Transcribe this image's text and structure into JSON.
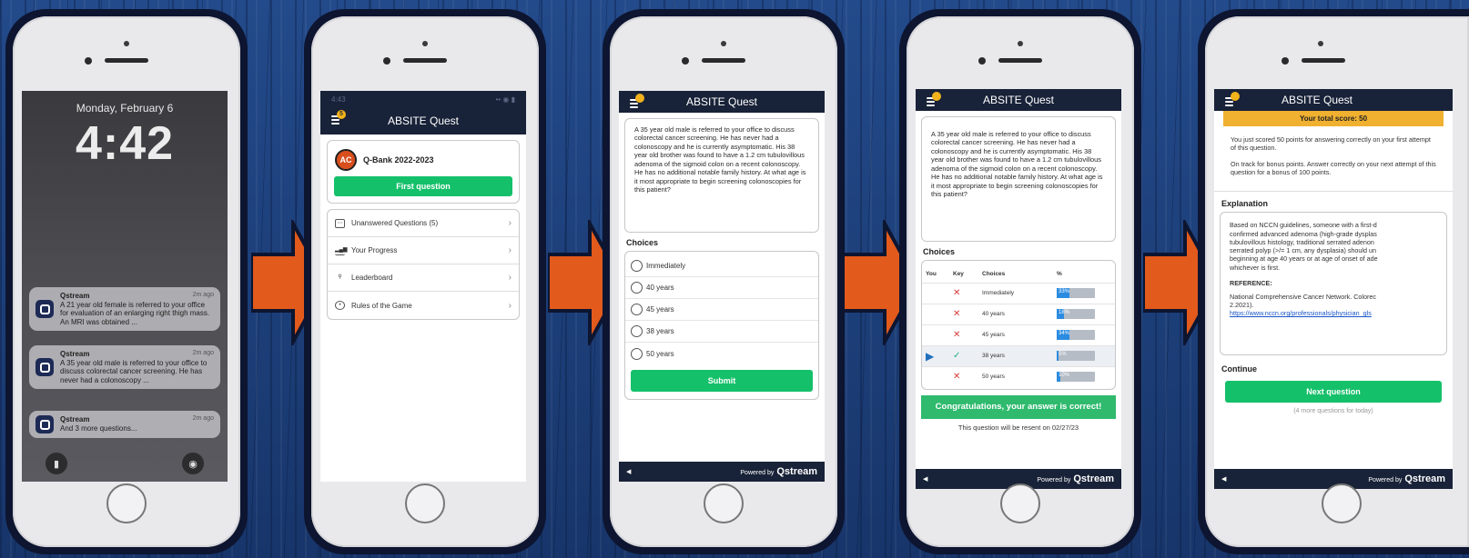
{
  "screen1": {
    "date": "Monday, February 6",
    "time": "4:42",
    "notifications": [
      {
        "app": "Qstream",
        "ago": "2m ago",
        "text": "A 21 year old female is referred to your office for evaluation of an enlarging right thigh mass. An MRI was obtained ..."
      },
      {
        "app": "Qstream",
        "ago": "2m ago",
        "text": "A 35 year old male is referred to your office to discuss colorectal cancer screening. He has never had a colonoscopy ..."
      },
      {
        "app": "Qstream",
        "ago": "2m ago",
        "text": "And 3 more questions..."
      }
    ]
  },
  "screen2": {
    "status_time": "4:43",
    "header_title": "ABSITE Quest",
    "coin_count": "5",
    "logo_text": "AC",
    "qbank_title": "Q-Bank 2022-2023",
    "first_question": "First question",
    "menu": [
      {
        "label": "Unanswered Questions (5)",
        "icon": "calendar-icon"
      },
      {
        "label": "Your Progress",
        "icon": "bar-chart-icon"
      },
      {
        "label": "Leaderboard",
        "icon": "trophy-icon"
      },
      {
        "label": "Rules of the Game",
        "icon": "help-icon"
      }
    ]
  },
  "question_text": "A 35 year old male is referred to your office to discuss colorectal cancer screening. He has never had a colonoscopy and he is currently asymptomatic. His 38 year old brother was found to have a 1.2 cm tubulovillous adenoma of the sigmoid colon on a recent colonoscopy. He has no additional notable family history. At what age is it most appropriate to begin screening colonoscopies for this patient?",
  "screen3": {
    "header_title": "ABSITE Quest",
    "choices_label": "Choices",
    "options": [
      "Immediately",
      "40 years",
      "45 years",
      "38 years",
      "50 years"
    ],
    "submit": "Submit",
    "powered_by": "Powered by",
    "brand": "Qstream"
  },
  "screen4": {
    "header_title": "ABSITE Quest",
    "choices_label": "Choices",
    "columns": [
      "You",
      "Key",
      "Choices",
      "%"
    ],
    "rows": [
      {
        "choice": "Immediately",
        "key": "wrong",
        "pct": 33,
        "pct_label": "33%",
        "you": false
      },
      {
        "choice": "40 years",
        "key": "wrong",
        "pct": 18,
        "pct_label": "18%",
        "you": false
      },
      {
        "choice": "45 years",
        "key": "wrong",
        "pct": 34,
        "pct_label": "34%",
        "you": false
      },
      {
        "choice": "38 years",
        "key": "correct",
        "pct": 5,
        "pct_label": "5%",
        "you": true
      },
      {
        "choice": "50 years",
        "key": "wrong",
        "pct": 10,
        "pct_label": "10%",
        "you": false
      }
    ],
    "congrats": "Congratulations, your answer is correct!",
    "resent": "This question will be resent on 02/27/23",
    "powered_by": "Powered by",
    "brand": "Qstream"
  },
  "screen5": {
    "header_title": "ABSITE Quest",
    "score": "Your total score: 50",
    "p1": "You just scored 50 points for answering correctly on your first attempt of this question.",
    "p2": "On track for bonus points. Answer correctly on your next attempt of this question for a bonus of 100 points.",
    "explanation_label": "Explanation",
    "explanation_lines": [
      "Based on NCCN guidelines, someone with a first-d",
      "confirmed advanced adenoma (high-grade dysplas",
      "tubulovillous histology, traditional serrated adenon",
      "serrated polyp (>/= 1 cm, any dysplasia) should un",
      "beginning at age 40 years or at age of onset of ade",
      "whichever is first."
    ],
    "reference_label": "REFERENCE:",
    "reference_lines": [
      "National Comprehensive Cancer Network. Colorec",
      "2.2021)."
    ],
    "reference_link": "https://www.nccn.org/professionals/physician_gls",
    "continue_label": "Continue",
    "next_question": "Next question",
    "more": "(4 more questions for today)",
    "powered_by": "Powered by",
    "brand": "Qstream"
  },
  "colors": {
    "accent_green": "#15c06a",
    "header_navy": "#182238",
    "arrow_orange": "#e25a1c",
    "score_yellow": "#f0b030"
  }
}
